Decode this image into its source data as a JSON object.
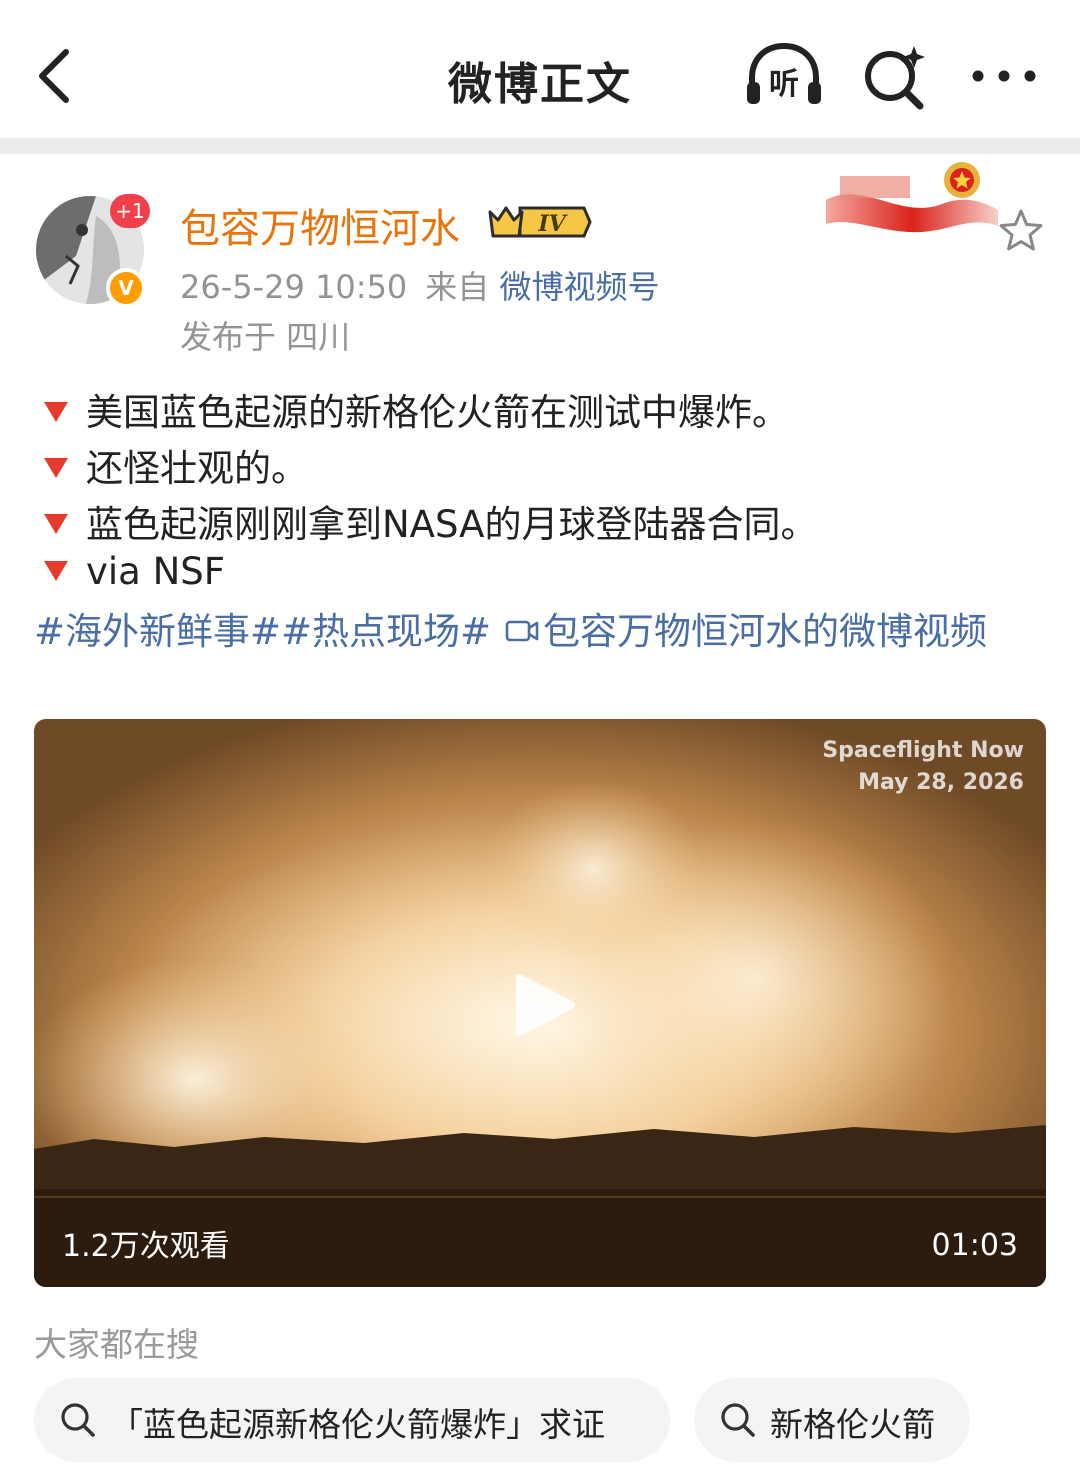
{
  "header": {
    "title": "微博正文",
    "listen_label": "听",
    "icons": {
      "back": "chevron-left-icon",
      "listen": "headphones-icon",
      "search": "search-sparkle-icon",
      "more": "more-dots-icon"
    }
  },
  "author": {
    "name": "包容万物恒河水",
    "plus_badge": "+1",
    "verified_badge": "V",
    "level_badge": "IV",
    "timestamp": "26-5-29 10:50",
    "from_label": "来自",
    "source": "微博视频号",
    "location": "发布于 四川"
  },
  "post": {
    "lines": [
      "美国蓝色起源的新格伦火箭在测试中爆炸。",
      "还怪壮观的。",
      "蓝色起源刚刚拿到NASA的月球登陆器合同。",
      "via NSF"
    ],
    "tags": "#海外新鲜事##热点现场#",
    "video_link": "包容万物恒河水的微博视频"
  },
  "video": {
    "watermark_line1": "Spaceflight Now",
    "watermark_line2": "May 28, 2026",
    "views": "1.2万次观看",
    "duration": "01:03"
  },
  "trending": {
    "heading": "大家都在搜",
    "chips": [
      "「蓝色起源新格伦火箭爆炸」求证",
      "新格伦火箭"
    ]
  },
  "colors": {
    "author_name": "#e8750b",
    "link_blue": "#4a6ea3",
    "triangle_red": "#e83b2e",
    "meta_gray": "#939393"
  }
}
